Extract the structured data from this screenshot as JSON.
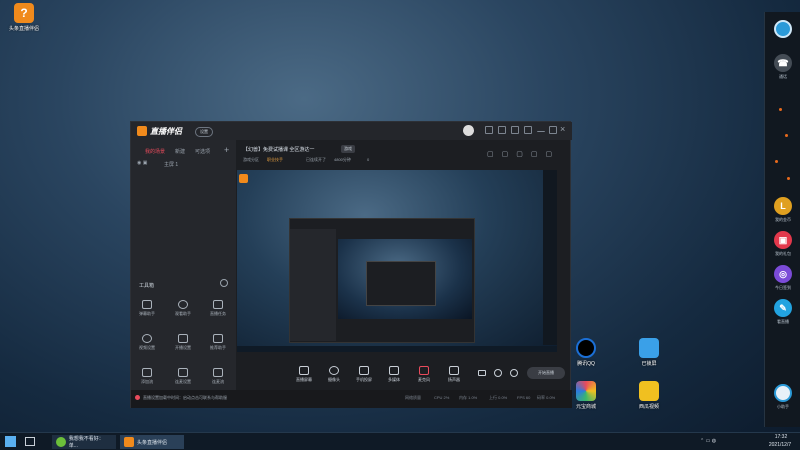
{
  "desktop": {
    "icons": [
      {
        "label": "头条直播伴侣",
        "color": "#f08a1c"
      },
      {
        "label": "腾讯QQ",
        "color": "#1b6fd6"
      },
      {
        "label": "已锁屏",
        "color": "#3aa0e8"
      },
      {
        "label": "元宝商城",
        "color": "#e94b5c"
      },
      {
        "label": "西瓜视频",
        "color": "#f0c020"
      }
    ]
  },
  "side_panel": {
    "items": [
      {
        "label": "",
        "icon": "circle-logo-icon",
        "color": "#2b9ad8"
      },
      {
        "label": "通话",
        "icon": "phone-icon",
        "color": "#444c55"
      },
      {
        "label": "我的金币",
        "icon": "coin-icon",
        "color": "#e0a020",
        "glyph": "L"
      },
      {
        "label": "我的礼包",
        "icon": "gift-icon",
        "color": "#e3384c"
      },
      {
        "label": "今日签到",
        "icon": "checkin-icon",
        "color": "#7b4bd8"
      },
      {
        "label": "看直播",
        "icon": "pencil-icon",
        "color": "#22a3e0"
      },
      {
        "label": "小助手",
        "icon": "assistant-icon",
        "color": "#e8f0f8"
      }
    ]
  },
  "app": {
    "title": "直播伴侣",
    "badge": "设置",
    "left_tabs": [
      "我的场景",
      "新建",
      "可选项"
    ],
    "scene_item": "主屏 1",
    "tools_title": "工具箱",
    "tools": [
      {
        "label": "弹幕助手",
        "icon": "message-icon"
      },
      {
        "label": "观看助手",
        "icon": "user-icon"
      },
      {
        "label": "直播任务",
        "icon": "task-icon"
      },
      {
        "label": "视频设置",
        "icon": "settings-icon"
      },
      {
        "label": "开播设置",
        "icon": "download-icon"
      },
      {
        "label": "推荐助手",
        "icon": "recommend-icon"
      },
      {
        "label": "添加流",
        "icon": "add-stream-icon"
      },
      {
        "label": "连麦设置",
        "icon": "mic-icon"
      },
      {
        "label": "连麦流",
        "icon": "link-icon"
      },
      {
        "label": "副屏",
        "icon": "screen-icon"
      },
      {
        "label": "礼物",
        "icon": "gift-icon"
      },
      {
        "label": "更多",
        "icon": "more-icon"
      }
    ],
    "room_title": "【幻兽】免费试播课 全区游达一",
    "room_tag": "游戏",
    "room_sub": [
      "游戏分区",
      "职业技手",
      "已连续开了",
      "4800分钟",
      "0"
    ],
    "bottom_tools": [
      {
        "label": "直播屏幕",
        "icon": "screen-icon"
      },
      {
        "label": "摄像头",
        "icon": "camera-icon"
      },
      {
        "label": "手机投屏",
        "icon": "phone-cast-icon"
      },
      {
        "label": "多媒体",
        "icon": "media-icon"
      },
      {
        "label": "麦克风",
        "icon": "microphone-icon"
      },
      {
        "label": "扬声器",
        "icon": "speaker-icon"
      }
    ],
    "start_button": "开始直播",
    "status_text": "直播设置加载中时间：启动点击可联系与帮助服",
    "status_metrics": [
      "网络质量",
      "CPU 2%",
      "内存 1.0%",
      "上行 0.0%",
      "FPS 60",
      "码率 0.0%"
    ]
  },
  "taskbar": {
    "apps": [
      {
        "label": "我想我不看好：单...",
        "color": "#6cbf3a"
      },
      {
        "label": "头条直播伴侣",
        "color": "#f08a1c"
      }
    ],
    "time": "17:32",
    "date": "2021/12/7"
  }
}
